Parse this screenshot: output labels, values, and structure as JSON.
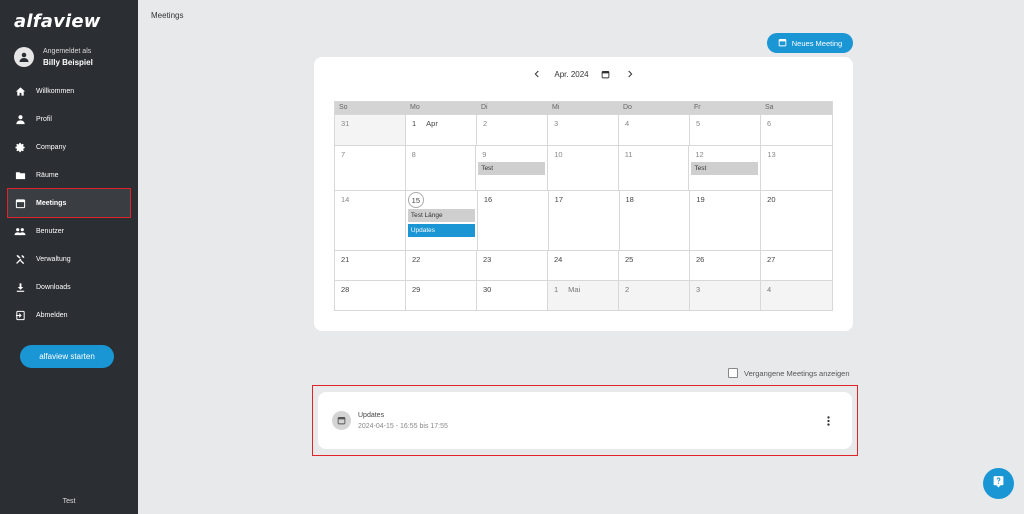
{
  "sidebar": {
    "logo": "alfaview",
    "user_status": "Angemeldet als",
    "user_name": "Billy Beispiel",
    "items": [
      {
        "label": "Willkommen",
        "icon": "home-icon"
      },
      {
        "label": "Profil",
        "icon": "person-icon"
      },
      {
        "label": "Company",
        "icon": "gear-icon"
      },
      {
        "label": "Räume",
        "icon": "folder-icon"
      },
      {
        "label": "Meetings",
        "icon": "calendar-icon",
        "active": true
      },
      {
        "label": "Benutzer",
        "icon": "people-icon"
      },
      {
        "label": "Verwaltung",
        "icon": "tools-icon"
      },
      {
        "label": "Downloads",
        "icon": "download-icon"
      },
      {
        "label": "Abmelden",
        "icon": "logout-icon"
      }
    ],
    "start_label": "alfaview starten",
    "footer": "Test"
  },
  "main": {
    "title": "Meetings",
    "new_meeting_label": "Neues Meeting"
  },
  "calendar": {
    "month_label": "Apr. 2024",
    "weekdays": [
      "So",
      "Mo",
      "Di",
      "Mi",
      "Do",
      "Fr",
      "Sa"
    ],
    "weeks": [
      [
        {
          "day": "31"
        },
        {
          "day": "1",
          "month": "Apr"
        },
        {
          "day": "2"
        },
        {
          "day": "3"
        },
        {
          "day": "4"
        },
        {
          "day": "5"
        },
        {
          "day": "6"
        }
      ],
      [
        {
          "day": "7"
        },
        {
          "day": "8"
        },
        {
          "day": "9",
          "events": [
            {
              "title": "Test"
            }
          ]
        },
        {
          "day": "10"
        },
        {
          "day": "11"
        },
        {
          "day": "12",
          "events": [
            {
              "title": "Test"
            }
          ]
        },
        {
          "day": "13"
        }
      ],
      [
        {
          "day": "14"
        },
        {
          "day": "15",
          "today": true,
          "events": [
            {
              "title": "Test Länge"
            },
            {
              "title": "Updates",
              "highlight": true
            }
          ]
        },
        {
          "day": "16"
        },
        {
          "day": "17"
        },
        {
          "day": "18"
        },
        {
          "day": "19"
        },
        {
          "day": "20"
        }
      ],
      [
        {
          "day": "21"
        },
        {
          "day": "22"
        },
        {
          "day": "23"
        },
        {
          "day": "24"
        },
        {
          "day": "25"
        },
        {
          "day": "26"
        },
        {
          "day": "27"
        }
      ],
      [
        {
          "day": "28"
        },
        {
          "day": "29"
        },
        {
          "day": "30"
        },
        {
          "day": "1",
          "month": "Mai"
        },
        {
          "day": "2"
        },
        {
          "day": "3"
        },
        {
          "day": "4"
        }
      ]
    ]
  },
  "past_meetings_label": "Vergangene Meetings anzeigen",
  "meeting": {
    "title": "Updates",
    "time": "2024-04-15 - 16:55 bis 17:55"
  },
  "colors": {
    "accent": "#1a96d4",
    "sidebar_bg": "#2b2e33",
    "highlight_border": "#e0252a"
  }
}
